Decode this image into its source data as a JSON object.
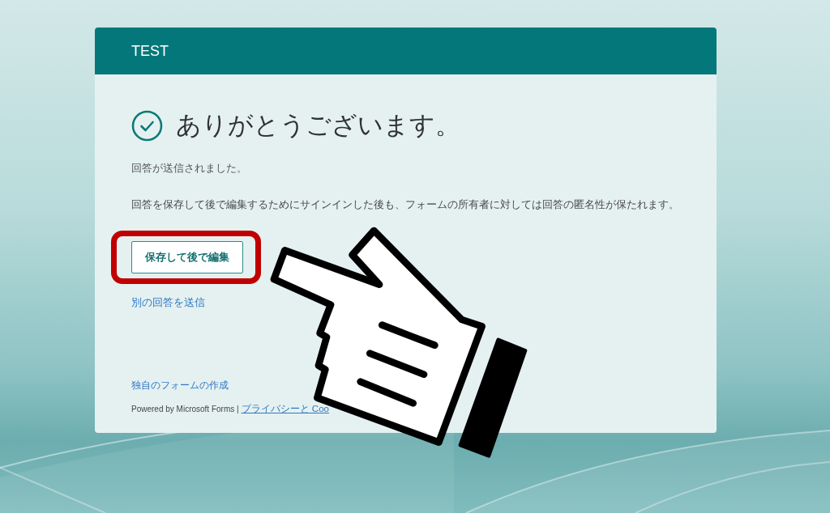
{
  "header": {
    "title": "TEST"
  },
  "confirmation": {
    "title": "ありがとうございます。",
    "message": "回答が送信されました。",
    "note": "回答を保存して後で編集するためにサインインした後も、フォームの所有者に対しては回答の匿名性が保たれます。"
  },
  "save_button": {
    "label": "保存して後で編集",
    "highlighted": true
  },
  "another_response_link": {
    "label": "別の回答を送信"
  },
  "footer": {
    "create_link": "独自のフォームの作成",
    "powered_by": "Powered by Microsoft Forms |",
    "privacy_link": "プライバシーと Coo"
  }
}
